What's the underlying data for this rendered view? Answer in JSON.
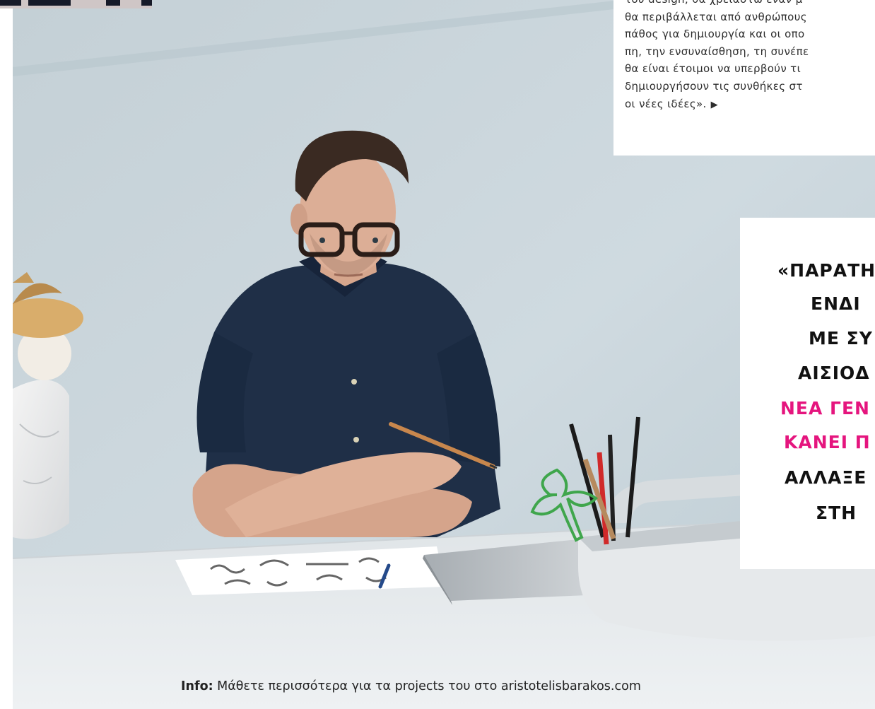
{
  "body_text": {
    "lines": [
      "του design, θα χρειαστώ έναν μ",
      "θα περιβάλλεται από ανθρώπους",
      "πάθος για δημιουργία και οι οπο",
      "πη, την ενσυναίσθηση, τη συνέπε",
      "θα είναι έτοιμοι να υπερβούν τι",
      "δημιουργήσουν τις συνθήκες στ",
      "οι νέες ιδέες»."
    ],
    "continue_marker": "▶"
  },
  "pull_quote": {
    "lines": [
      {
        "text": "«ΠΑΡΑΤΗ",
        "accent": false
      },
      {
        "text": "ΕΝΔΙ",
        "accent": false
      },
      {
        "text": "ΜΕ ΣΥ",
        "accent": false
      },
      {
        "text": "ΑΙΣΙΟΔ",
        "accent": false
      },
      {
        "text": "ΝΕΑ ΓΕΝ",
        "accent": true
      },
      {
        "text": "ΚΑΝΕΙ Π",
        "accent": true
      },
      {
        "text": "ΑΛΛΑΞΕ",
        "accent": false
      },
      {
        "text": "ΣΤΗ",
        "accent": false
      }
    ],
    "accent_color": "#e5157e"
  },
  "caption": {
    "label": "Info:",
    "text": " Μάθετε περισσότερα για τα projects του στο aristotelisbarakos.com"
  },
  "colors": {
    "wall": "#c9d6dc",
    "desk": "#e3e7ea",
    "shirt": "#1f2f47",
    "accent_pink": "#e5157e"
  }
}
